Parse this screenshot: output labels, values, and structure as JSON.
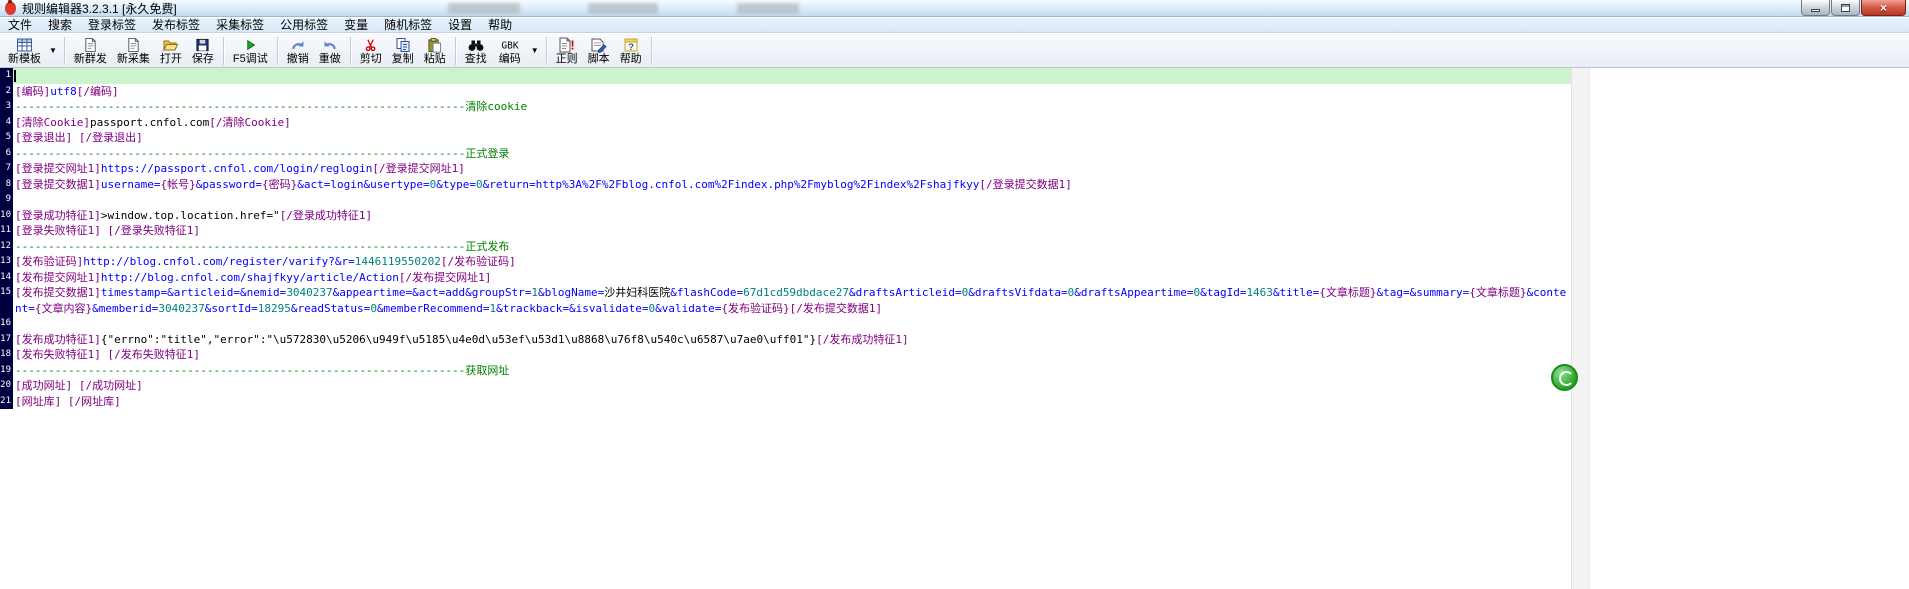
{
  "title_bar": {
    "title": "规则编辑器3.2.3.1 [永久免费]"
  },
  "window_controls": {
    "minimize": "minimize",
    "maximize": "maximize",
    "close": "close"
  },
  "menu_bar": {
    "items": [
      "文件",
      "搜索",
      "登录标签",
      "发布标签",
      "采集标签",
      "公用标签",
      "变量",
      "随机标签",
      "设置",
      "帮助"
    ]
  },
  "toolbar": {
    "groups": [
      [
        {
          "label": "新模板",
          "icon": "template-grid",
          "dropdown": true
        }
      ],
      [
        {
          "label": "新群发",
          "icon": "doc-new"
        },
        {
          "label": "新采集",
          "icon": "doc-new"
        },
        {
          "label": "打开",
          "icon": "folder-open"
        },
        {
          "label": "保存",
          "icon": "floppy"
        }
      ],
      [
        {
          "label": "F5调试",
          "icon": "play"
        }
      ],
      [
        {
          "label": "撤销",
          "icon": "undo"
        },
        {
          "label": "重做",
          "icon": "redo"
        }
      ],
      [
        {
          "label": "剪切",
          "icon": "scissors"
        },
        {
          "label": "复制",
          "icon": "copy"
        },
        {
          "label": "粘贴",
          "icon": "paste"
        }
      ],
      [
        {
          "label": "查找",
          "icon": "binoculars"
        },
        {
          "label": "编码",
          "icon": "gbk-text",
          "dropdown": true
        }
      ],
      [
        {
          "label": "正则",
          "icon": "doc-exclaim"
        },
        {
          "label": "脚本",
          "icon": "doc-script"
        },
        {
          "label": "帮助",
          "icon": "help"
        }
      ]
    ]
  },
  "colors": {
    "tag": "#800080",
    "text": "#0000ff",
    "number": "#008080",
    "comment": "#008000",
    "plain": "#000000",
    "current_line_bg": "#ccf3cc",
    "gutter_bg": "#000040",
    "badge_green": "#2aa52a"
  },
  "editor": {
    "lines": [
      {
        "num": "1",
        "current": true,
        "segments": []
      },
      {
        "num": "2",
        "segments": [
          {
            "t": "[编码]",
            "c": "tag"
          },
          {
            "t": "utf8",
            "c": "txt"
          },
          {
            "t": "[/编码]",
            "c": "tag"
          }
        ]
      },
      {
        "num": "3",
        "segments": [
          {
            "t": "--------------------------------------------------------------------清除cookie",
            "c": "cmt"
          }
        ]
      },
      {
        "num": "4",
        "segments": [
          {
            "t": "[清除Cookie]",
            "c": "tag"
          },
          {
            "t": "passport.cnfol.com",
            "c": "plain"
          },
          {
            "t": "[/清除Cookie]",
            "c": "tag"
          }
        ]
      },
      {
        "num": "5",
        "segments": [
          {
            "t": "[登录退出]",
            "c": "tag"
          },
          {
            "t": " ",
            "c": "plain"
          },
          {
            "t": "[/登录退出]",
            "c": "tag"
          }
        ]
      },
      {
        "num": "6",
        "segments": [
          {
            "t": "--------------------------------------------------------------------正式登录",
            "c": "cmt"
          }
        ]
      },
      {
        "num": "7",
        "segments": [
          {
            "t": "[登录提交网址1]",
            "c": "tag"
          },
          {
            "t": "https://passport.cnfol.com/login/reglogin",
            "c": "txt"
          },
          {
            "t": "[/登录提交网址1]",
            "c": "tag"
          }
        ]
      },
      {
        "num": "8",
        "segments": [
          {
            "t": "[登录提交数据1]",
            "c": "tag"
          },
          {
            "t": "username=",
            "c": "txt"
          },
          {
            "t": "{帐号}",
            "c": "tag"
          },
          {
            "t": "&password=",
            "c": "txt"
          },
          {
            "t": "{密码}",
            "c": "tag"
          },
          {
            "t": "&act=login&usertype=",
            "c": "txt"
          },
          {
            "t": "0",
            "c": "num"
          },
          {
            "t": "&type=",
            "c": "txt"
          },
          {
            "t": "0",
            "c": "num"
          },
          {
            "t": "&return=http%3A%2F%2Fblog.cnfol.com%2Findex.php%2Fmyblog%2Findex%2Fshajfkyy",
            "c": "txt"
          },
          {
            "t": "[/登录提交数据1]",
            "c": "tag"
          }
        ]
      },
      {
        "num": "9",
        "segments": []
      },
      {
        "num": "10",
        "segments": [
          {
            "t": "[登录成功特征1]",
            "c": "tag"
          },
          {
            "t": ">window.top.location.href=\"",
            "c": "plain"
          },
          {
            "t": "[/登录成功特征1]",
            "c": "tag"
          }
        ]
      },
      {
        "num": "11",
        "segments": [
          {
            "t": "[登录失败特征1]",
            "c": "tag"
          },
          {
            "t": " ",
            "c": "plain"
          },
          {
            "t": "[/登录失败特征1]",
            "c": "tag"
          }
        ]
      },
      {
        "num": "12",
        "segments": [
          {
            "t": "--------------------------------------------------------------------正式发布",
            "c": "cmt"
          }
        ]
      },
      {
        "num": "13",
        "segments": [
          {
            "t": "[发布验证码]",
            "c": "tag"
          },
          {
            "t": "http://blog.cnfol.com/register/varify?&r=",
            "c": "txt"
          },
          {
            "t": "1446119550202",
            "c": "num"
          },
          {
            "t": "[/发布验证码]",
            "c": "tag"
          }
        ]
      },
      {
        "num": "14",
        "segments": [
          {
            "t": "[发布提交网址1]",
            "c": "tag"
          },
          {
            "t": "http://blog.cnfol.com/shajfkyy/article/Action",
            "c": "txt"
          },
          {
            "t": "[/发布提交网址1]",
            "c": "tag"
          }
        ]
      },
      {
        "num": "15",
        "segments": [
          {
            "t": "[发布提交数据1]",
            "c": "tag"
          },
          {
            "t": "timestamp=&articleid=&nemid=",
            "c": "txt"
          },
          {
            "t": "3040237",
            "c": "num"
          },
          {
            "t": "&appeartime=&act=add&groupStr=",
            "c": "txt"
          },
          {
            "t": "1",
            "c": "num"
          },
          {
            "t": "&blogName=",
            "c": "txt"
          },
          {
            "t": "沙井妇科医院",
            "c": "plain"
          },
          {
            "t": "&flashCode=",
            "c": "txt"
          },
          {
            "t": "67d1cd59dbdace27",
            "c": "num"
          },
          {
            "t": "&draftsArticleid=",
            "c": "txt"
          },
          {
            "t": "0",
            "c": "num"
          },
          {
            "t": "&draftsVifdata=",
            "c": "txt"
          },
          {
            "t": "0",
            "c": "num"
          },
          {
            "t": "&draftsAppeartime=",
            "c": "txt"
          },
          {
            "t": "0",
            "c": "num"
          },
          {
            "t": "&tagId=",
            "c": "txt"
          },
          {
            "t": "1463",
            "c": "num"
          },
          {
            "t": "&title=",
            "c": "txt"
          },
          {
            "t": "{文章标题}",
            "c": "tag"
          },
          {
            "t": "&tag=&summary=",
            "c": "txt"
          },
          {
            "t": "{文章标题}",
            "c": "tag"
          },
          {
            "t": "&content=",
            "c": "txt"
          },
          {
            "t": "{文章内容}",
            "c": "tag"
          },
          {
            "t": "&memberid=",
            "c": "txt"
          },
          {
            "t": "3040237",
            "c": "num"
          },
          {
            "t": "&sortId=",
            "c": "txt"
          },
          {
            "t": "18295",
            "c": "num"
          },
          {
            "t": "&readStatus=",
            "c": "txt"
          },
          {
            "t": "0",
            "c": "num"
          },
          {
            "t": "&memberRecommend=",
            "c": "txt"
          },
          {
            "t": "1",
            "c": "num"
          },
          {
            "t": "&trackback=&isvalidate=",
            "c": "txt"
          },
          {
            "t": "0",
            "c": "num"
          },
          {
            "t": "&validate=",
            "c": "txt"
          },
          {
            "t": "{发布验证码}",
            "c": "tag"
          },
          {
            "t": "[/发布提交数据1]",
            "c": "tag"
          }
        ]
      },
      {
        "num": "16",
        "segments": []
      },
      {
        "num": "17",
        "segments": [
          {
            "t": "[发布成功特征1]",
            "c": "tag"
          },
          {
            "t": "{\"errno\":\"title\",\"error\":\"\\u572830\\u5206\\u949f\\u5185\\u4e0d\\u53ef\\u53d1\\u8868\\u76f8\\u540c\\u6587\\u7ae0\\uff01\"}",
            "c": "plain"
          },
          {
            "t": "[/发布成功特征1]",
            "c": "tag"
          }
        ]
      },
      {
        "num": "18",
        "segments": [
          {
            "t": "[发布失败特征1]",
            "c": "tag"
          },
          {
            "t": " ",
            "c": "plain"
          },
          {
            "t": "[/发布失败特征1]",
            "c": "tag"
          }
        ]
      },
      {
        "num": "19",
        "segments": [
          {
            "t": "--------------------------------------------------------------------获取网址",
            "c": "cmt"
          }
        ]
      },
      {
        "num": "20",
        "segments": [
          {
            "t": "[成功网址]",
            "c": "tag"
          },
          {
            "t": " ",
            "c": "plain"
          },
          {
            "t": "[/成功网址]",
            "c": "tag"
          }
        ]
      },
      {
        "num": "21",
        "segments": [
          {
            "t": "[网址库]",
            "c": "tag"
          },
          {
            "t": " ",
            "c": "plain"
          },
          {
            "t": "[/网址库]",
            "c": "tag"
          }
        ]
      }
    ]
  }
}
